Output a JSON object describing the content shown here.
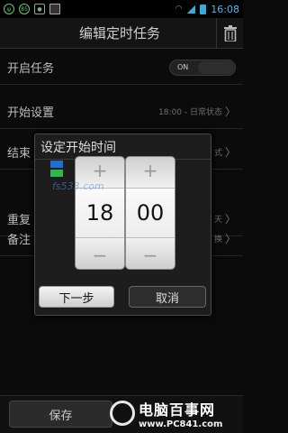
{
  "status_bar": {
    "time": "16:08",
    "badge": "85"
  },
  "header": {
    "title": "编辑定时任务"
  },
  "rows": [
    {
      "label": "开启任务",
      "value": "ON"
    },
    {
      "label": "开始设置",
      "value": "18:00 - 日常状态"
    },
    {
      "label": "结束",
      "value": "式"
    },
    {
      "label": "重复",
      "value": "天"
    },
    {
      "label": "备注",
      "value": "换"
    }
  ],
  "dialog": {
    "title": "设定开始时间",
    "hour": "18",
    "minute": "00",
    "plus": "+",
    "minus": "−",
    "next_label": "下一步",
    "cancel_label": "取消"
  },
  "footer": {
    "save_label": "保存"
  },
  "watermarks": {
    "center_text": "fs533.com",
    "logo_name": "电脑百事网",
    "logo_url": "www.PC841.com"
  },
  "colors": {
    "status_accent": "#4fb8f0",
    "picker_face": "#ffffff"
  }
}
